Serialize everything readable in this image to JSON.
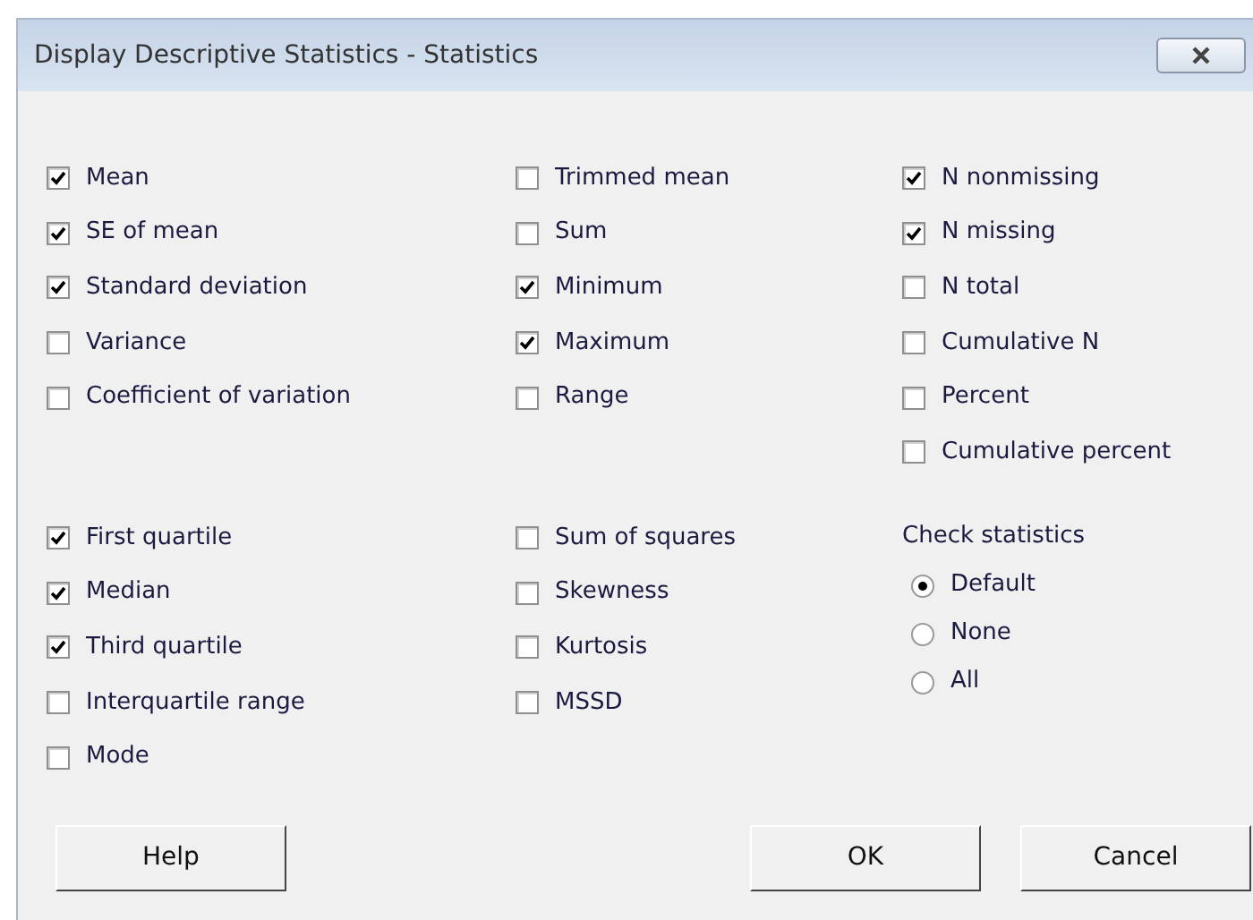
{
  "window": {
    "title": "Display Descriptive Statistics - Statistics"
  },
  "sections": [
    {
      "columns": [
        [
          {
            "label": "Mean",
            "checked": true
          },
          {
            "label": "SE of mean",
            "checked": true
          },
          {
            "label": "Standard deviation",
            "checked": true
          },
          {
            "label": "Variance",
            "checked": false
          },
          {
            "label": "Coefficient of variation",
            "checked": false
          }
        ],
        [
          {
            "label": "Trimmed mean",
            "checked": false
          },
          {
            "label": "Sum",
            "checked": false
          },
          {
            "label": "Minimum",
            "checked": true
          },
          {
            "label": "Maximum",
            "checked": true
          },
          {
            "label": "Range",
            "checked": false
          }
        ],
        [
          {
            "label": "N nonmissing",
            "checked": true
          },
          {
            "label": "N missing",
            "checked": true
          },
          {
            "label": "N total",
            "checked": false
          },
          {
            "label": "Cumulative N",
            "checked": false
          },
          {
            "label": "Percent",
            "checked": false
          },
          {
            "label": "Cumulative percent",
            "checked": false
          }
        ]
      ]
    },
    {
      "columns": [
        [
          {
            "label": "First quartile",
            "checked": true
          },
          {
            "label": "Median",
            "checked": true
          },
          {
            "label": "Third quartile",
            "checked": true
          },
          {
            "label": "Interquartile range",
            "checked": false
          },
          {
            "label": "Mode",
            "checked": false
          }
        ],
        [
          {
            "label": "Sum of squares",
            "checked": false
          },
          {
            "label": "Skewness",
            "checked": false
          },
          {
            "label": "Kurtosis",
            "checked": false
          },
          {
            "label": "MSSD",
            "checked": false
          }
        ]
      ]
    }
  ],
  "check_statistics": {
    "label": "Check statistics",
    "options": [
      {
        "label": "Default",
        "selected": true
      },
      {
        "label": "None",
        "selected": false
      },
      {
        "label": "All",
        "selected": false
      }
    ]
  },
  "buttons": [
    {
      "label": "Help"
    },
    {
      "label": "OK"
    },
    {
      "label": "Cancel"
    }
  ]
}
